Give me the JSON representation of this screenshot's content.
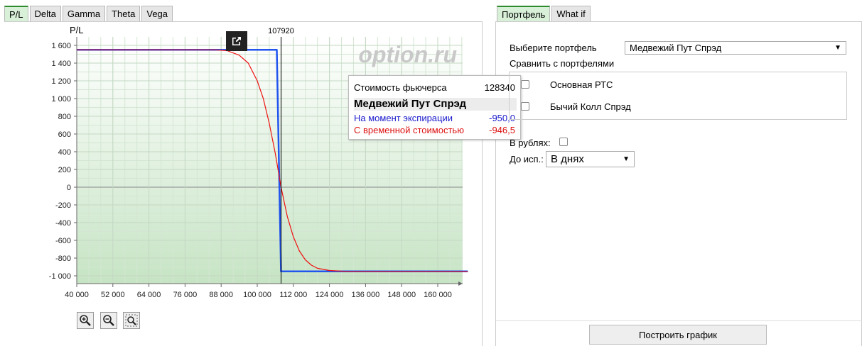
{
  "left_tabs": [
    "P/L",
    "Delta",
    "Gamma",
    "Theta",
    "Vega"
  ],
  "right_tabs": [
    "Портфель",
    "What if"
  ],
  "chart": {
    "ylabel": "P/L",
    "watermark": "option.ru",
    "cursor_label": "107920"
  },
  "chart_data": {
    "type": "line",
    "xlabel": "",
    "ylabel": "P/L",
    "xlim": [
      40000,
      170000
    ],
    "ylim": [
      -1100,
      1700
    ],
    "x_ticks": [
      "40 000",
      "52 000",
      "64 000",
      "76 000",
      "88 000",
      "100 000",
      "112 000",
      "124 000",
      "136 000",
      "148 000",
      "160 000"
    ],
    "y_ticks": [
      "1 600",
      "1 400",
      "1 200",
      "1 000",
      "800",
      "600",
      "400",
      "200",
      "0",
      "-200",
      "-400",
      "-600",
      "-800",
      "-1 000"
    ],
    "cursor_x": 107920,
    "series": [
      {
        "color": "#2255ee",
        "points": [
          [
            40000,
            1550
          ],
          [
            88000,
            1550
          ],
          [
            106500,
            1550
          ],
          [
            107900,
            -950
          ],
          [
            170000,
            -950
          ]
        ]
      },
      {
        "color": "#ee1111",
        "points": [
          [
            40000,
            1550
          ],
          [
            86000,
            1550
          ],
          [
            90000,
            1540
          ],
          [
            94000,
            1490
          ],
          [
            97000,
            1400
          ],
          [
            100000,
            1200
          ],
          [
            102000,
            1000
          ],
          [
            104000,
            720
          ],
          [
            106000,
            380
          ],
          [
            107920,
            0
          ],
          [
            110000,
            -330
          ],
          [
            112000,
            -560
          ],
          [
            114000,
            -720
          ],
          [
            116000,
            -820
          ],
          [
            118000,
            -880
          ],
          [
            120000,
            -915
          ],
          [
            124000,
            -940
          ],
          [
            130000,
            -950
          ],
          [
            170000,
            -950
          ]
        ]
      }
    ]
  },
  "tooltip": {
    "futures_label": "Стоимость фьючерса",
    "futures_value": "128340",
    "portfolio_name": "Медвежий Пут Спрэд",
    "expiry_label": "На момент экспирации",
    "expiry_value": "-950,0",
    "time_label": "С временной стоимостью",
    "time_value": "-946,5"
  },
  "form": {
    "select_portfolio_label": "Выберите портфель",
    "selected_portfolio": "Медвежий Пут Спрэд",
    "compare_label": "Сравнить с портфелями",
    "compare_items": [
      "Основная РТС",
      "Бычий Колл Спрэд"
    ],
    "rubles_label": "В рублях:",
    "to_exp_label": "До исп.:",
    "to_exp_value": "В днях",
    "build_button": "Построить график"
  }
}
